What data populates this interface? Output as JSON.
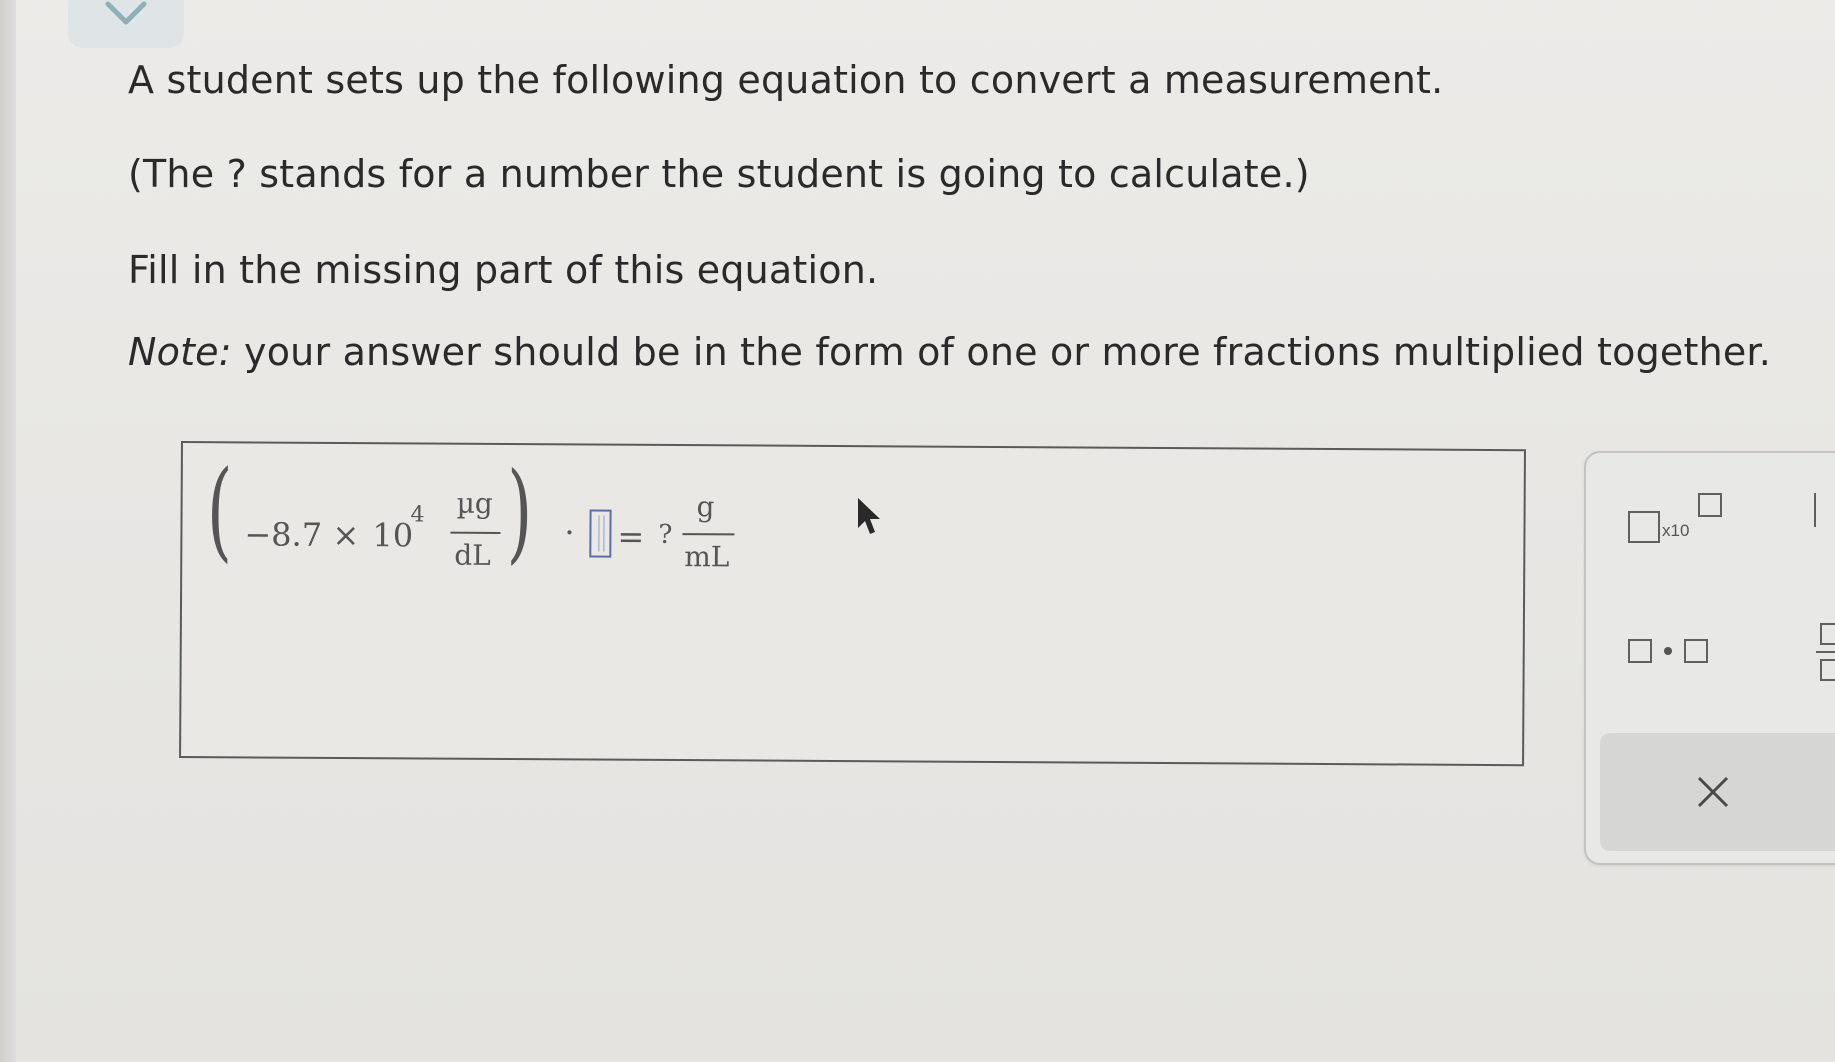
{
  "question": {
    "line1": "A student sets up the following equation to convert a measurement.",
    "line2": "(The ? stands for a number the student is going to calculate.)",
    "line3": "Fill in the missing part of this equation.",
    "note_label": "Note:",
    "note_text": " your answer should be in the form of one or more fractions multiplied together."
  },
  "equation": {
    "open_paren": "(",
    "minus_value": "−8.7",
    "times": "×",
    "base": "10",
    "exponent": "4",
    "numerator_unit": "µg",
    "denominator_unit": "dL",
    "close_paren": ")",
    "dot": "·",
    "equals": "=",
    "unknown": "?",
    "result_numerator": "g",
    "result_denominator": "mL"
  },
  "toolbar": {
    "sci_notation_label": "x10"
  },
  "colors": {
    "slot_border": "#5a6fa8",
    "chevron": "#8fb0b8",
    "panel_border": "#c3c3c1"
  },
  "icons": [
    "chevron-down-icon",
    "cursor-icon",
    "close-icon"
  ]
}
